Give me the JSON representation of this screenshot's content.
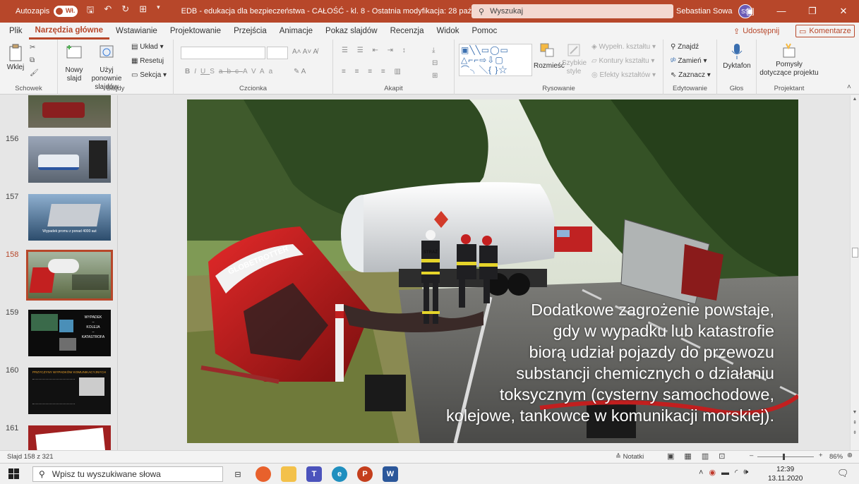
{
  "titlebar": {
    "autosave_label": "Autozapis",
    "autosave_state": "Wł.",
    "doc_title": "EDB - edukacja dla bezpieczeństwa - CAŁOŚĆ - kl. 8 - Ostatnia modyfikacja: 28 października",
    "search_placeholder": "Wyszukaj",
    "user_name": "Sebastian Sowa",
    "user_initials": "SS"
  },
  "tabs": [
    "Plik",
    "Narzędzia główne",
    "Wstawianie",
    "Projektowanie",
    "Przejścia",
    "Animacje",
    "Pokaz slajdów",
    "Recenzja",
    "Widok",
    "Pomoc"
  ],
  "share_label": "Udostępnij",
  "comments_label": "Komentarze",
  "ribbon": {
    "clipboard": {
      "paste": "Wklej",
      "label": "Schowek"
    },
    "slides": {
      "new_slide": "Nowy slajd",
      "reuse": "Użyj ponownie slajdów",
      "layout": "Układ",
      "reset": "Resetuj",
      "section": "Sekcja",
      "label": "Slajdy"
    },
    "font": {
      "label": "Czcionka",
      "format_buttons": [
        "B",
        "I",
        "U",
        "S",
        "abc",
        "AV",
        "Aa"
      ]
    },
    "paragraph": {
      "label": "Akapit"
    },
    "drawing": {
      "arrange": "Rozmieść",
      "quick_styles": "Szybkie style",
      "shape_fill": "Wypełn. kształtu",
      "shape_outline": "Kontury kształtu",
      "shape_effects": "Efekty kształtów",
      "label": "Rysowanie"
    },
    "editing": {
      "find": "Znajdź",
      "replace": "Zamień",
      "select": "Zaznacz",
      "label": "Edytowanie"
    },
    "voice": {
      "dictate": "Dyktafon",
      "label": "Głos"
    },
    "designer": {
      "ideas": "Pomysły dotyczące projektu",
      "label": "Projektant"
    }
  },
  "thumbnails": [
    {
      "num": "156"
    },
    {
      "num": "157",
      "caption": "Wypadek promu z ponad 4000 aut"
    },
    {
      "num": "158",
      "selected": true
    },
    {
      "num": "159",
      "title_lines": [
        "WYPADEK",
        "–",
        "KOLEJA",
        "–",
        "KATASTROFA"
      ]
    },
    {
      "num": "160",
      "title": "PRZYCZYNY WYPADKÓW KOMUNIKACYJNYCH"
    },
    {
      "num": "161"
    }
  ],
  "slide": {
    "text_lines": [
      "Dodatkowe zagrożenie powstaje,",
      "gdy w wypadku lub katastrofie",
      "biorą udział pojazdy do przewozu",
      "substancji chemicznych o działaniu",
      "toksycznym (cysterny samochodowe,",
      "kolejowe, tankowce w komunikacji morskiej)."
    ],
    "truck_brand": "GLOBETROTTER",
    "vest_text": "STRAŻ"
  },
  "status": {
    "slide_counter": "Slajd 158 z 321",
    "notes": "Notatki",
    "zoom": "86%"
  },
  "taskbar": {
    "search_placeholder": "Wpisz tu wyszukiwane słowa",
    "time": "12:39",
    "date": "13.11.2020"
  }
}
